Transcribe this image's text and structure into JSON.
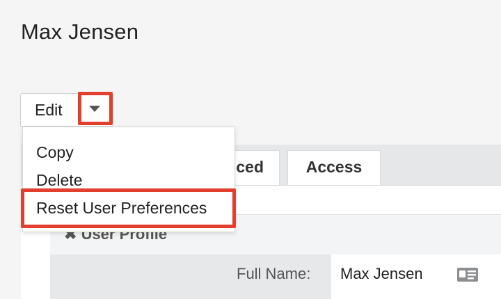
{
  "page": {
    "title": "Max Jensen"
  },
  "actions": {
    "edit_label": "Edit",
    "menu": [
      {
        "label": "Copy"
      },
      {
        "label": "Delete"
      },
      {
        "label": "Reset User Preferences"
      }
    ]
  },
  "tabs": [
    {
      "label": "ced"
    },
    {
      "label": "Access"
    }
  ],
  "panel": {
    "header": "User Profile",
    "fields": [
      {
        "label": "Full Name:",
        "value": "Max Jensen",
        "icon": "contact-card-icon"
      }
    ]
  },
  "colors": {
    "highlight": "#e0402d",
    "tabbar_bg": "#e6e7e8",
    "label_bg": "#e6e8ea"
  }
}
